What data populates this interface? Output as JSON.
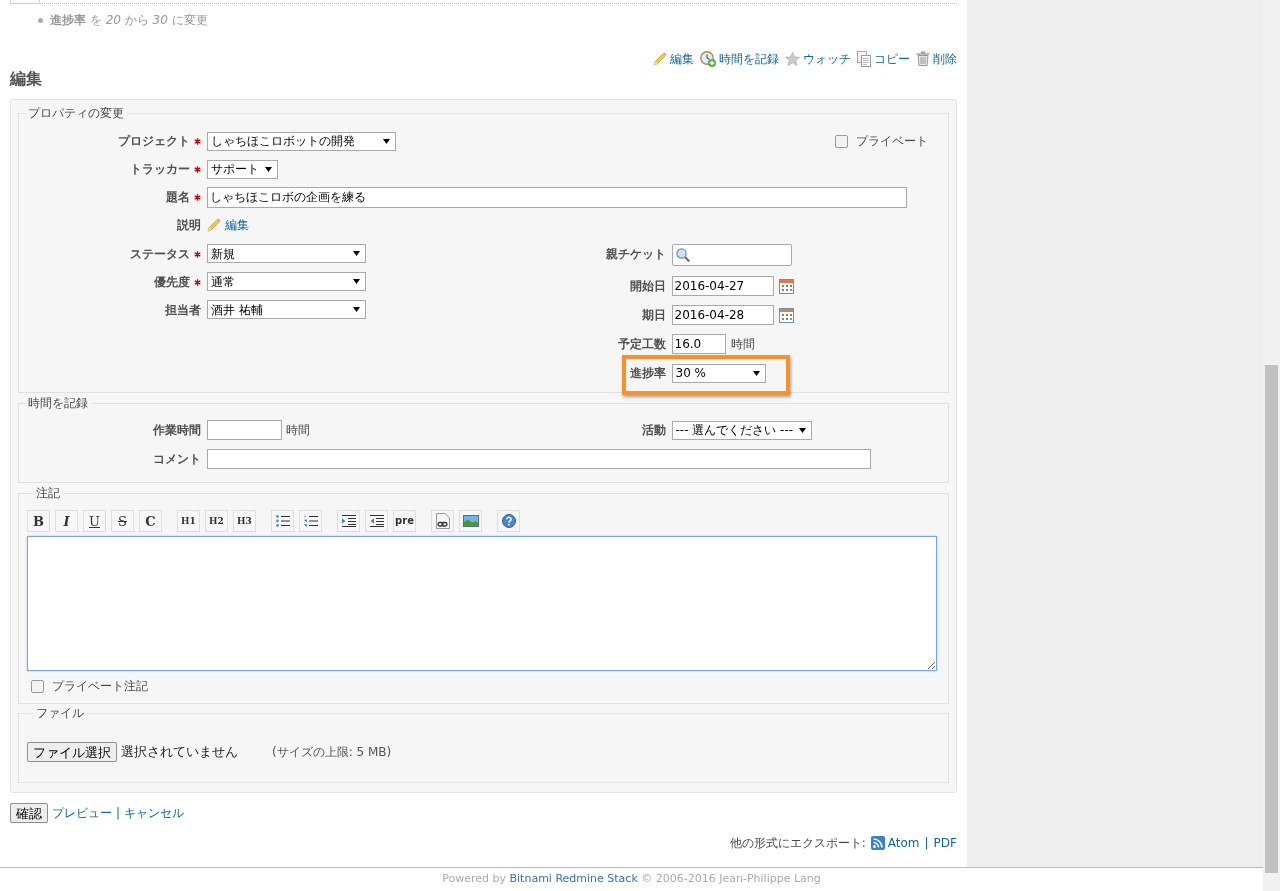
{
  "journal": {
    "details": [
      {
        "text": "**進捗率** を *20* から *30* に変更"
      }
    ]
  },
  "actions_menu": [
    {
      "kind": "edit",
      "label": "編集"
    },
    {
      "kind": "log_time",
      "label": "時間を記録"
    },
    {
      "kind": "watch",
      "label": "ウォッチ"
    },
    {
      "kind": "copy",
      "label": "コピー"
    },
    {
      "kind": "delete",
      "label": "削除"
    }
  ],
  "heading": "編集",
  "properties": {
    "legend": "プロパティの変更",
    "private": {
      "label": "プライベート",
      "checked": false
    },
    "fields": [
      {
        "kind": "select",
        "label": "プロジェクト",
        "required": true,
        "value": "しゃちほこロボットの開発"
      },
      {
        "kind": "select",
        "label": "トラッカー",
        "required": true,
        "value": "サポート"
      },
      {
        "kind": "text",
        "label": "題名",
        "required": true,
        "value": "しゃちほこロボの企画を練る"
      },
      {
        "kind": "edit_link",
        "label": "説明",
        "required": false,
        "link": "編集"
      }
    ],
    "left_fields": [
      {
        "kind": "select",
        "label": "ステータス",
        "required": true,
        "value": "新規"
      },
      {
        "kind": "select",
        "label": "優先度",
        "required": true,
        "value": "通常"
      },
      {
        "kind": "select",
        "label": "担当者",
        "required": false,
        "value": "酒井 祐輔"
      }
    ],
    "right_fields": [
      {
        "kind": "search",
        "label": "親チケット",
        "required": false,
        "highlighted": false
      },
      {
        "kind": "date",
        "label": "開始日",
        "required": false,
        "value": "2016-04-27",
        "highlighted": false
      },
      {
        "kind": "date",
        "label": "期日",
        "required": false,
        "value": "2016-04-28",
        "highlighted": false
      },
      {
        "kind": "hours",
        "label": "予定工数",
        "required": false,
        "value": "16.0",
        "unit": "時間",
        "highlighted": false
      },
      {
        "kind": "select",
        "label": "進捗率",
        "required": false,
        "value": "30 %",
        "highlighted": true
      }
    ]
  },
  "time_entry": {
    "legend": "時間を記録",
    "hours": {
      "label": "作業時間",
      "unit": "時間"
    },
    "activity": {
      "label": "活動",
      "value": "--- 選んでください ---"
    },
    "comment": {
      "label": "コメント"
    }
  },
  "notes": {
    "legend": "注記",
    "toolbar": [
      [
        {
          "kind": "bold",
          "label": "B"
        },
        {
          "kind": "italic",
          "label": "I"
        },
        {
          "kind": "underline",
          "label": "U"
        },
        {
          "kind": "strike",
          "label": "S"
        },
        {
          "kind": "code",
          "label": "C"
        }
      ],
      [
        {
          "kind": "h1",
          "label": "H1"
        },
        {
          "kind": "h2",
          "label": "H2"
        },
        {
          "kind": "h3",
          "label": "H3"
        }
      ],
      [
        {
          "kind": "ul"
        },
        {
          "kind": "ol"
        }
      ],
      [
        {
          "kind": "quote"
        },
        {
          "kind": "unquote"
        },
        {
          "kind": "pre",
          "label": "pre"
        }
      ],
      [
        {
          "kind": "link"
        },
        {
          "kind": "image"
        }
      ],
      [
        {
          "kind": "help"
        }
      ]
    ],
    "private_notes": {
      "label": "プライベート注記",
      "checked": false
    }
  },
  "files": {
    "legend": "ファイル",
    "button": "ファイル選択",
    "status": "選択されていません",
    "limit": "(サイズの上限: 5 MB)"
  },
  "form_actions": {
    "submit": "確認",
    "links": [
      "プレビュー",
      "キャンセル"
    ],
    "separator": "|"
  },
  "export": {
    "label": "他の形式にエクスポート:",
    "links": [
      {
        "kind": "atom",
        "label": "Atom"
      },
      {
        "kind": "pdf",
        "label": "PDF"
      }
    ],
    "separator": "|"
  },
  "footer": {
    "prefix": "Powered by",
    "link": "Bitnami Redmine Stack",
    "suffix": "© 2006-2016 Jean-Philippe Lang"
  }
}
